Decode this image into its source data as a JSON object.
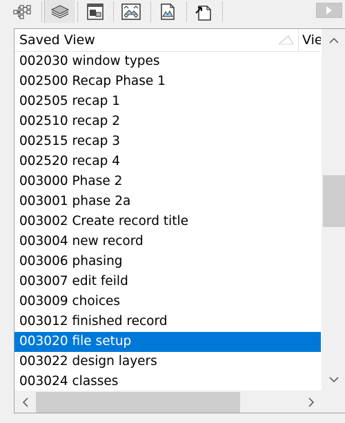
{
  "toolbar": {
    "buttons": [
      {
        "name": "hierarchy-icon"
      },
      {
        "name": "layers-icon"
      },
      {
        "name": "window-icon"
      },
      {
        "name": "fit-view-icon"
      },
      {
        "name": "image-document-icon"
      },
      {
        "name": "export-icon"
      }
    ],
    "nav_next_icon": "triangle-right-icon"
  },
  "list": {
    "columns": [
      {
        "label": "Saved View"
      },
      {
        "label": "View"
      }
    ],
    "rows": [
      "002030 window types",
      "002500 Recap Phase 1",
      "002505 recap 1",
      "002510 recap 2",
      "002515 recap 3",
      "002520 recap 4",
      "003000 Phase 2",
      "003001 phase 2a",
      "003002 Create record title",
      "003004 new record",
      "003006 phasing",
      "003007 edit feild",
      "003009 choices",
      "003012 finished record",
      "003020 file setup",
      "003022 design layers",
      "003024 classes"
    ],
    "selected_row": "003020 file setup"
  },
  "colors": {
    "selection": "#0078d7",
    "scroll_thumb": "#cdcdcd"
  }
}
